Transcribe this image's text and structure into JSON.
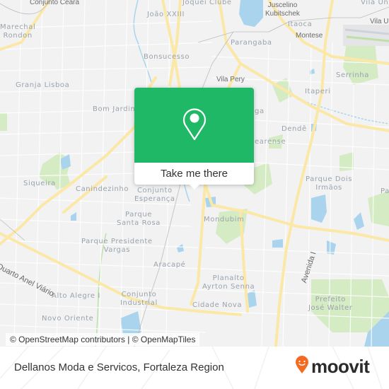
{
  "map": {
    "neighborhoods": [
      {
        "id": "conjunto-ceara",
        "label": "Conjunto Ceará",
        "style": "dark"
      },
      {
        "id": "joao-xxiii",
        "label": "João XXIII"
      },
      {
        "id": "joquei-clube",
        "label": "Jóquei Clube"
      },
      {
        "id": "juscelino-kubitschek",
        "label": "Juscelino\nKubitschek",
        "style": "dark"
      },
      {
        "id": "vila-uniao-1",
        "label": "Vila Un"
      },
      {
        "id": "vila-uniao-2",
        "label": "Vila U",
        "style": "dark"
      },
      {
        "id": "marechal-rondon",
        "label": "Marechal\nRondon"
      },
      {
        "id": "itaoca",
        "label": "Itaoca"
      },
      {
        "id": "montese",
        "label": "Montese",
        "style": "dark"
      },
      {
        "id": "bonsucesso",
        "label": "Bonsucesso"
      },
      {
        "id": "parangaba",
        "label": "Parangaba"
      },
      {
        "id": "vila-pery",
        "label": "Vila Pery",
        "style": "dark"
      },
      {
        "id": "granja-lisboa",
        "label": "Granja Lisboa"
      },
      {
        "id": "serrinha",
        "label": "Serrinha"
      },
      {
        "id": "itaperi",
        "label": "Itaperi"
      },
      {
        "id": "bom-jardim",
        "label": "Bom Jardim"
      },
      {
        "id": "maraponga",
        "label": "ga"
      },
      {
        "id": "dende",
        "label": "Dendê"
      },
      {
        "id": "cearense",
        "label": "earense"
      },
      {
        "id": "siqueira",
        "label": "Siqueira"
      },
      {
        "id": "canindezinho",
        "label": "Canindezinho"
      },
      {
        "id": "conjunto-esperanca",
        "label": "Conjunto\nEsperança"
      },
      {
        "id": "parque-dois-irmaos",
        "label": "Parque Dois\nIrmãos"
      },
      {
        "id": "pa",
        "label": "Pa"
      },
      {
        "id": "parque-santa-rosa",
        "label": "Parque\nSanta Rosa"
      },
      {
        "id": "mondubim",
        "label": "Mondubim"
      },
      {
        "id": "parque-presidente-vargas",
        "label": "Parque Presidente\nVargas"
      },
      {
        "id": "aracape",
        "label": "Aracapé"
      },
      {
        "id": "planalto-ayrton-senna",
        "label": "Planalto\nAyrton Senna"
      },
      {
        "id": "alto-alegre",
        "label": "Alto Alegre I"
      },
      {
        "id": "conjunto-industrial",
        "label": "Conjunto\nIndustrial"
      },
      {
        "id": "cidade-nova",
        "label": "Cidade Nova"
      },
      {
        "id": "novo-oriente",
        "label": "Novo Oriente"
      },
      {
        "id": "prefeito-jose-walter",
        "label": "Prefeito\nJosé Walter"
      }
    ],
    "roads": [
      {
        "id": "quarto-anel-viario",
        "label": "Via Quarto Anel Viário"
      },
      {
        "id": "avenida-i",
        "label": "Avenida I"
      }
    ],
    "attribution": "© OpenStreetMap contributors | © OpenMapTiles"
  },
  "popup": {
    "icon": "map-pin-icon",
    "button_label": "Take me there",
    "color": "#1fb866"
  },
  "footer": {
    "place_title": "Dellanos Moda e Servicos, Fortaleza Region",
    "brand": "moovit",
    "brand_color": "#f26b21"
  }
}
